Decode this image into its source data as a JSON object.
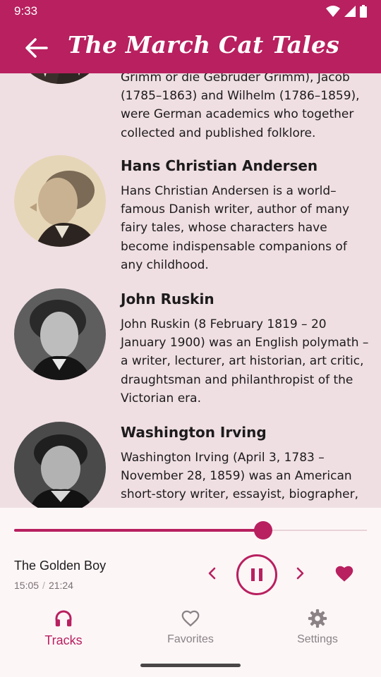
{
  "status_bar": {
    "time": "9:33"
  },
  "app_bar": {
    "title": "The March Cat Tales"
  },
  "authors": [
    {
      "name": "",
      "description": "Grimm or die Gebrüder Grimm), Jacob (1785–1863) and Wilhelm (1786–1859), were German academics who together collected and published folklore."
    },
    {
      "name": "Hans Christian Andersen",
      "description": "Hans Christian Andersen is a world–famous Danish writer, author of many fairy tales, whose characters have become indispensable companions of any childhood."
    },
    {
      "name": "John Ruskin",
      "description": "John Ruskin (8 February 1819 – 20 January 1900) was an English polymath – a writer, lecturer, art historian, art critic, draughtsman and philanthropist of the Victorian era."
    },
    {
      "name": "Washington Irving",
      "description": "Washington Irving (April 3, 1783 – November 28, 1859) was an American short-story writer, essayist, biographer,"
    }
  ],
  "player": {
    "track_title": "The Golden Boy",
    "elapsed": "15:05",
    "separator": "/",
    "duration": "21:24",
    "progress_fraction": 0.705
  },
  "bottom_nav": {
    "items": [
      {
        "label": "Tracks",
        "icon": "headphones-icon",
        "active": true
      },
      {
        "label": "Favorites",
        "icon": "heart-outline-icon",
        "active": false
      },
      {
        "label": "Settings",
        "icon": "gear-icon",
        "active": false
      }
    ]
  },
  "colors": {
    "primary": "#b8205f",
    "background": "#efdfe3",
    "surface": "#fdf6f7",
    "inactive": "#8a8285"
  }
}
